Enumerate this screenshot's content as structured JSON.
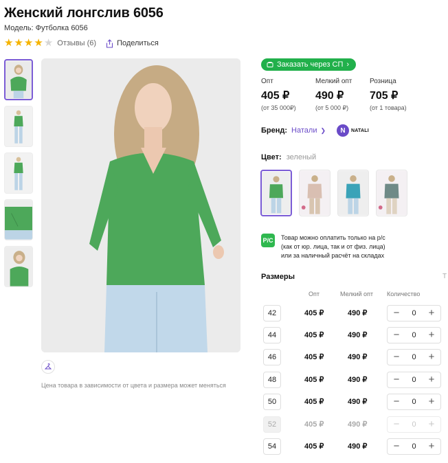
{
  "product": {
    "title": "Женский лонгслив 6056",
    "model": "Модель: Футболка 6056",
    "rating": 4,
    "rating_max": 5,
    "reviews": "Отзывы (6)",
    "share": "Поделиться"
  },
  "gallery": {
    "thumbnails": [
      "thumb-1",
      "thumb-2",
      "thumb-3",
      "thumb-4",
      "thumb-5"
    ],
    "active_index": 0,
    "price_note": "Цена товара в зависимости от цвета и размера может меняться"
  },
  "order_button": {
    "label": "Заказать через СП",
    "color": "#21b04b"
  },
  "prices": [
    {
      "label": "Опт",
      "value": "405 ₽",
      "sub": "(от 35 000₽)"
    },
    {
      "label": "Мелкий опт",
      "value": "490 ₽",
      "sub": "(от 5 000 ₽)"
    },
    {
      "label": "Розница",
      "value": "705 ₽",
      "sub": "(от 1 товара)"
    }
  ],
  "brand": {
    "label": "Бренд:",
    "name": "Натали",
    "logo_letter": "N",
    "logo_text": "NATALI",
    "accent": "#6a4bc8"
  },
  "color": {
    "label": "Цвет:",
    "value": "зеленый",
    "swatches": [
      {
        "name": "green",
        "hex": "#4da85a"
      },
      {
        "name": "beige",
        "hex": "#d9bfb2"
      },
      {
        "name": "teal",
        "hex": "#3aa3b8"
      },
      {
        "name": "grey",
        "hex": "#6f8a87"
      }
    ],
    "active_index": 0
  },
  "payment": {
    "icon": "Р/С",
    "line1": "Товар можно оплатить только на р/с",
    "line2": "(как от юр. лица, так и от физ. лица)",
    "line3": "или за наличный расчёт на складах"
  },
  "sizes": {
    "title": "Размеры",
    "table_link": "Т",
    "headers": {
      "opt": "Опт",
      "small_opt": "Мелкий опт",
      "quantity": "Количество"
    },
    "rows": [
      {
        "size": "42",
        "opt": "405 ₽",
        "small": "490 ₽",
        "qty": "0",
        "available": true
      },
      {
        "size": "44",
        "opt": "405 ₽",
        "small": "490 ₽",
        "qty": "0",
        "available": true
      },
      {
        "size": "46",
        "opt": "405 ₽",
        "small": "490 ₽",
        "qty": "0",
        "available": true
      },
      {
        "size": "48",
        "opt": "405 ₽",
        "small": "490 ₽",
        "qty": "0",
        "available": true
      },
      {
        "size": "50",
        "opt": "405 ₽",
        "small": "490 ₽",
        "qty": "0",
        "available": true
      },
      {
        "size": "52",
        "opt": "405 ₽",
        "small": "490 ₽",
        "qty": "0",
        "available": false
      },
      {
        "size": "54",
        "opt": "405 ₽",
        "small": "490 ₽",
        "qty": "0",
        "available": true
      }
    ],
    "minus": "−",
    "plus": "+"
  }
}
